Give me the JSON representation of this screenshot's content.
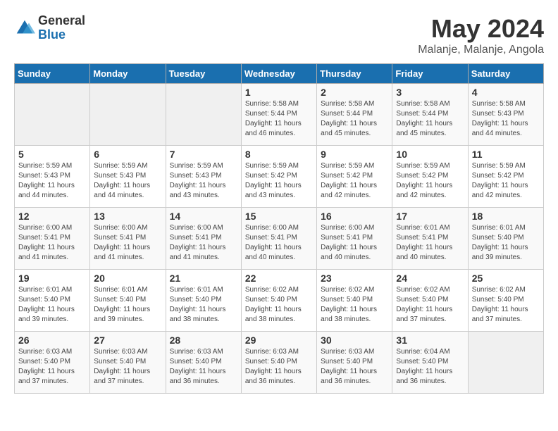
{
  "logo": {
    "general": "General",
    "blue": "Blue"
  },
  "title": {
    "month": "May 2024",
    "location": "Malanje, Malanje, Angola"
  },
  "headers": [
    "Sunday",
    "Monday",
    "Tuesday",
    "Wednesday",
    "Thursday",
    "Friday",
    "Saturday"
  ],
  "weeks": [
    [
      {
        "day": "",
        "info": ""
      },
      {
        "day": "",
        "info": ""
      },
      {
        "day": "",
        "info": ""
      },
      {
        "day": "1",
        "info": "Sunrise: 5:58 AM\nSunset: 5:44 PM\nDaylight: 11 hours\nand 46 minutes."
      },
      {
        "day": "2",
        "info": "Sunrise: 5:58 AM\nSunset: 5:44 PM\nDaylight: 11 hours\nand 45 minutes."
      },
      {
        "day": "3",
        "info": "Sunrise: 5:58 AM\nSunset: 5:44 PM\nDaylight: 11 hours\nand 45 minutes."
      },
      {
        "day": "4",
        "info": "Sunrise: 5:58 AM\nSunset: 5:43 PM\nDaylight: 11 hours\nand 44 minutes."
      }
    ],
    [
      {
        "day": "5",
        "info": "Sunrise: 5:59 AM\nSunset: 5:43 PM\nDaylight: 11 hours\nand 44 minutes."
      },
      {
        "day": "6",
        "info": "Sunrise: 5:59 AM\nSunset: 5:43 PM\nDaylight: 11 hours\nand 44 minutes."
      },
      {
        "day": "7",
        "info": "Sunrise: 5:59 AM\nSunset: 5:43 PM\nDaylight: 11 hours\nand 43 minutes."
      },
      {
        "day": "8",
        "info": "Sunrise: 5:59 AM\nSunset: 5:42 PM\nDaylight: 11 hours\nand 43 minutes."
      },
      {
        "day": "9",
        "info": "Sunrise: 5:59 AM\nSunset: 5:42 PM\nDaylight: 11 hours\nand 42 minutes."
      },
      {
        "day": "10",
        "info": "Sunrise: 5:59 AM\nSunset: 5:42 PM\nDaylight: 11 hours\nand 42 minutes."
      },
      {
        "day": "11",
        "info": "Sunrise: 5:59 AM\nSunset: 5:42 PM\nDaylight: 11 hours\nand 42 minutes."
      }
    ],
    [
      {
        "day": "12",
        "info": "Sunrise: 6:00 AM\nSunset: 5:41 PM\nDaylight: 11 hours\nand 41 minutes."
      },
      {
        "day": "13",
        "info": "Sunrise: 6:00 AM\nSunset: 5:41 PM\nDaylight: 11 hours\nand 41 minutes."
      },
      {
        "day": "14",
        "info": "Sunrise: 6:00 AM\nSunset: 5:41 PM\nDaylight: 11 hours\nand 41 minutes."
      },
      {
        "day": "15",
        "info": "Sunrise: 6:00 AM\nSunset: 5:41 PM\nDaylight: 11 hours\nand 40 minutes."
      },
      {
        "day": "16",
        "info": "Sunrise: 6:00 AM\nSunset: 5:41 PM\nDaylight: 11 hours\nand 40 minutes."
      },
      {
        "day": "17",
        "info": "Sunrise: 6:01 AM\nSunset: 5:41 PM\nDaylight: 11 hours\nand 40 minutes."
      },
      {
        "day": "18",
        "info": "Sunrise: 6:01 AM\nSunset: 5:40 PM\nDaylight: 11 hours\nand 39 minutes."
      }
    ],
    [
      {
        "day": "19",
        "info": "Sunrise: 6:01 AM\nSunset: 5:40 PM\nDaylight: 11 hours\nand 39 minutes."
      },
      {
        "day": "20",
        "info": "Sunrise: 6:01 AM\nSunset: 5:40 PM\nDaylight: 11 hours\nand 39 minutes."
      },
      {
        "day": "21",
        "info": "Sunrise: 6:01 AM\nSunset: 5:40 PM\nDaylight: 11 hours\nand 38 minutes."
      },
      {
        "day": "22",
        "info": "Sunrise: 6:02 AM\nSunset: 5:40 PM\nDaylight: 11 hours\nand 38 minutes."
      },
      {
        "day": "23",
        "info": "Sunrise: 6:02 AM\nSunset: 5:40 PM\nDaylight: 11 hours\nand 38 minutes."
      },
      {
        "day": "24",
        "info": "Sunrise: 6:02 AM\nSunset: 5:40 PM\nDaylight: 11 hours\nand 37 minutes."
      },
      {
        "day": "25",
        "info": "Sunrise: 6:02 AM\nSunset: 5:40 PM\nDaylight: 11 hours\nand 37 minutes."
      }
    ],
    [
      {
        "day": "26",
        "info": "Sunrise: 6:03 AM\nSunset: 5:40 PM\nDaylight: 11 hours\nand 37 minutes."
      },
      {
        "day": "27",
        "info": "Sunrise: 6:03 AM\nSunset: 5:40 PM\nDaylight: 11 hours\nand 37 minutes."
      },
      {
        "day": "28",
        "info": "Sunrise: 6:03 AM\nSunset: 5:40 PM\nDaylight: 11 hours\nand 36 minutes."
      },
      {
        "day": "29",
        "info": "Sunrise: 6:03 AM\nSunset: 5:40 PM\nDaylight: 11 hours\nand 36 minutes."
      },
      {
        "day": "30",
        "info": "Sunrise: 6:03 AM\nSunset: 5:40 PM\nDaylight: 11 hours\nand 36 minutes."
      },
      {
        "day": "31",
        "info": "Sunrise: 6:04 AM\nSunset: 5:40 PM\nDaylight: 11 hours\nand 36 minutes."
      },
      {
        "day": "",
        "info": ""
      }
    ]
  ]
}
